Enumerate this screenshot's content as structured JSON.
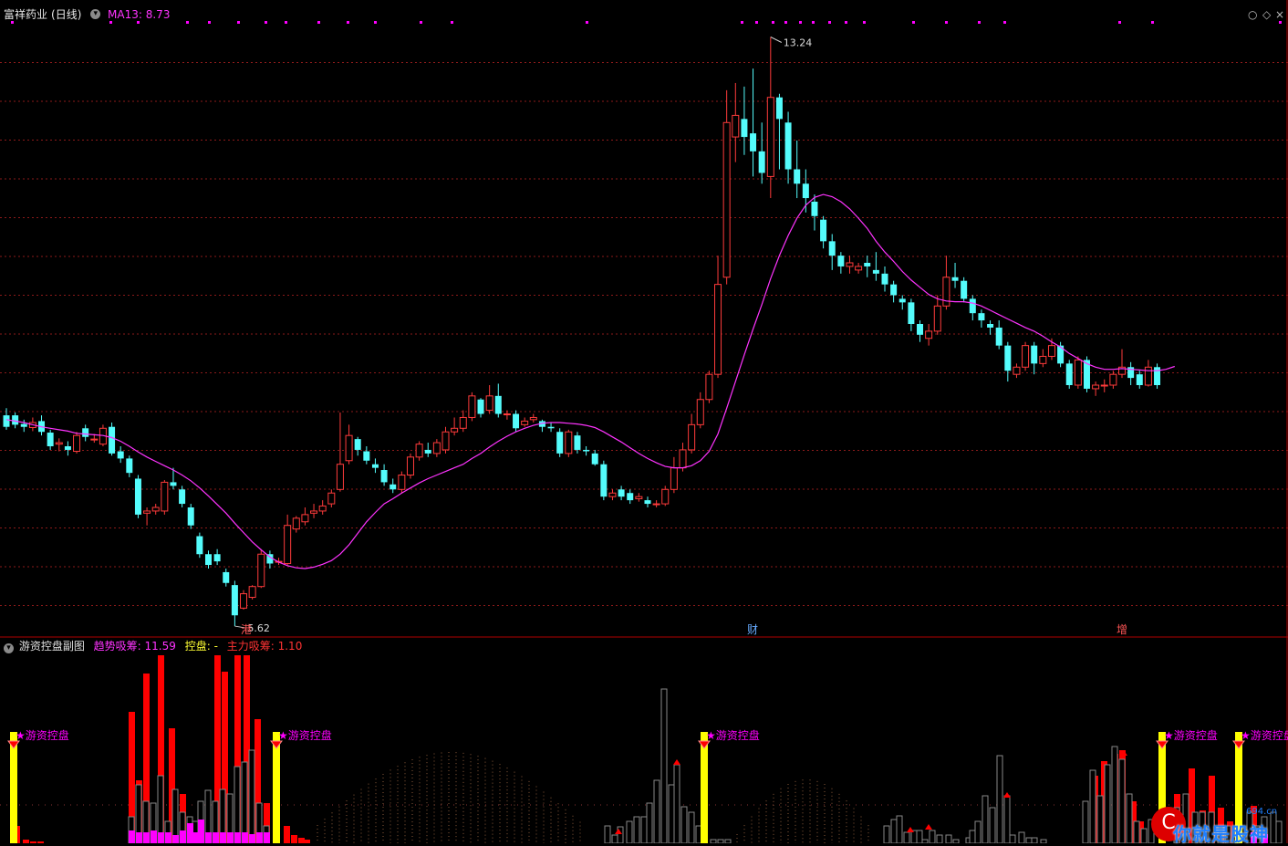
{
  "stock": {
    "name": "富祥药业",
    "period": "(日线)",
    "ma_label": "MA13: 8.73"
  },
  "sub": {
    "name": "游资控盘副图",
    "trend_label": "趋势吸筹: 11.59",
    "ctrl_label": "控盘: -",
    "main_label": "主力吸筹: 1.10",
    "signal_label": "★游资控盘"
  },
  "window_buttons": [
    "○",
    "◇",
    "×"
  ],
  "event_markers": [
    "港",
    "财",
    "增"
  ],
  "colors": {
    "up": "#ff3b3b",
    "down": "#54fcfc",
    "ma": "#ff33ff",
    "grid": "#8b1a1a",
    "yellow": "#ffff00",
    "magenta": "#ff00ff",
    "red": "#ff0000"
  },
  "chart_data": {
    "type": "candlestick",
    "title": "富祥药业 (日线)",
    "y_range": [
      5.0,
      13.5
    ],
    "high_label": "13.24",
    "low_label": "5.62",
    "ma13_current": 8.73,
    "candles": [
      [
        7.98,
        7.82,
        8.08,
        7.78
      ],
      [
        7.98,
        7.85,
        8.02,
        7.8
      ],
      [
        7.86,
        7.82,
        7.92,
        7.75
      ],
      [
        7.81,
        7.88,
        7.95,
        7.76
      ],
      [
        7.9,
        7.75,
        7.98,
        7.7
      ],
      [
        7.74,
        7.55,
        7.78,
        7.5
      ],
      [
        7.58,
        7.6,
        7.66,
        7.48
      ],
      [
        7.55,
        7.5,
        7.62,
        7.42
      ],
      [
        7.48,
        7.7,
        7.75,
        7.45
      ],
      [
        7.8,
        7.68,
        7.85,
        7.62
      ],
      [
        7.65,
        7.65,
        7.72,
        7.6
      ],
      [
        7.58,
        7.8,
        7.85,
        7.55
      ],
      [
        7.82,
        7.45,
        7.88,
        7.42
      ],
      [
        7.48,
        7.38,
        7.55,
        7.32
      ],
      [
        7.38,
        7.18,
        7.42,
        7.12
      ],
      [
        7.1,
        6.6,
        7.15,
        6.55
      ],
      [
        6.62,
        6.65,
        6.7,
        6.45
      ],
      [
        6.65,
        6.7,
        6.75,
        6.6
      ],
      [
        6.65,
        7.05,
        7.08,
        6.6
      ],
      [
        7.05,
        7.0,
        7.25,
        6.95
      ],
      [
        6.95,
        6.75,
        7.0,
        6.7
      ],
      [
        6.7,
        6.45,
        6.75,
        6.4
      ],
      [
        6.3,
        6.05,
        6.35,
        6.0
      ],
      [
        6.05,
        5.9,
        6.1,
        5.85
      ],
      [
        6.05,
        5.95,
        6.12,
        5.9
      ],
      [
        5.8,
        5.65,
        5.85,
        5.6
      ],
      [
        5.62,
        5.2,
        5.68,
        5.05
      ],
      [
        5.3,
        5.5,
        5.55,
        5.28
      ],
      [
        5.45,
        5.6,
        5.62,
        5.42
      ],
      [
        5.6,
        6.05,
        6.12,
        5.58
      ],
      [
        6.05,
        5.92,
        6.1,
        5.85
      ],
      [
        5.95,
        5.95,
        6.0,
        5.9
      ],
      [
        5.92,
        6.45,
        6.6,
        5.9
      ],
      [
        6.4,
        6.55,
        6.58,
        6.35
      ],
      [
        6.5,
        6.6,
        6.7,
        6.45
      ],
      [
        6.62,
        6.65,
        6.75,
        6.55
      ],
      [
        6.65,
        6.72,
        6.8,
        6.6
      ],
      [
        6.75,
        6.9,
        6.95,
        6.7
      ],
      [
        6.95,
        7.3,
        8.02,
        6.92
      ],
      [
        7.35,
        7.7,
        7.85,
        7.3
      ],
      [
        7.65,
        7.5,
        7.68,
        7.42
      ],
      [
        7.48,
        7.35,
        7.55,
        7.3
      ],
      [
        7.3,
        7.25,
        7.38,
        7.18
      ],
      [
        7.22,
        7.05,
        7.3,
        7.0
      ],
      [
        7.02,
        6.95,
        7.1,
        6.9
      ],
      [
        6.95,
        7.15,
        7.2,
        6.9
      ],
      [
        7.15,
        7.4,
        7.45,
        7.1
      ],
      [
        7.4,
        7.58,
        7.62,
        7.35
      ],
      [
        7.5,
        7.45,
        7.6,
        7.4
      ],
      [
        7.45,
        7.6,
        7.65,
        7.4
      ],
      [
        7.5,
        7.75,
        7.82,
        7.45
      ],
      [
        7.75,
        7.8,
        7.95,
        7.7
      ],
      [
        7.8,
        7.95,
        8.05,
        7.75
      ],
      [
        7.95,
        8.25,
        8.3,
        7.9
      ],
      [
        8.2,
        8.0,
        8.22,
        7.95
      ],
      [
        8.05,
        8.25,
        8.4,
        8.0
      ],
      [
        8.25,
        8.0,
        8.42,
        7.95
      ],
      [
        8.0,
        8.0,
        8.05,
        7.92
      ],
      [
        8.0,
        7.8,
        8.05,
        7.75
      ],
      [
        7.85,
        7.9,
        7.95,
        7.82
      ],
      [
        7.92,
        7.95,
        8.0,
        7.88
      ],
      [
        7.9,
        7.82,
        7.92,
        7.75
      ],
      [
        7.82,
        7.8,
        7.88,
        7.75
      ],
      [
        7.75,
        7.45,
        7.8,
        7.4
      ],
      [
        7.45,
        7.75,
        7.78,
        7.4
      ],
      [
        7.7,
        7.5,
        7.75,
        7.45
      ],
      [
        7.5,
        7.48,
        7.55,
        7.42
      ],
      [
        7.45,
        7.3,
        7.5,
        7.28
      ],
      [
        7.3,
        6.85,
        7.35,
        6.8
      ],
      [
        6.85,
        6.9,
        6.95,
        6.8
      ],
      [
        6.95,
        6.85,
        7.0,
        6.8
      ],
      [
        6.9,
        6.8,
        6.95,
        6.75
      ],
      [
        6.82,
        6.85,
        6.9,
        6.78
      ],
      [
        6.8,
        6.75,
        6.85,
        6.7
      ],
      [
        6.75,
        6.75,
        6.8,
        6.7
      ],
      [
        6.75,
        6.95,
        7.0,
        6.72
      ],
      [
        6.95,
        7.25,
        7.4,
        6.9
      ],
      [
        7.25,
        7.5,
        7.6,
        7.2
      ],
      [
        7.5,
        7.85,
        8.0,
        7.45
      ],
      [
        7.85,
        8.2,
        8.3,
        7.8
      ],
      [
        8.2,
        8.55,
        8.6,
        8.15
      ],
      [
        8.55,
        9.8,
        10.2,
        8.5
      ],
      [
        9.9,
        12.05,
        12.5,
        9.8
      ],
      [
        11.85,
        12.15,
        12.6,
        11.5
      ],
      [
        12.1,
        11.85,
        12.55,
        11.6
      ],
      [
        11.9,
        11.65,
        12.8,
        11.3
      ],
      [
        11.65,
        11.35,
        12.05,
        11.2
      ],
      [
        11.3,
        12.4,
        13.24,
        11.0
      ],
      [
        12.4,
        12.1,
        12.45,
        11.4
      ],
      [
        12.05,
        11.4,
        12.2,
        11.2
      ],
      [
        11.4,
        11.2,
        11.8,
        11.0
      ],
      [
        11.2,
        11.0,
        11.4,
        10.8
      ],
      [
        10.95,
        10.75,
        11.05,
        10.55
      ],
      [
        10.7,
        10.4,
        10.75,
        10.3
      ],
      [
        10.4,
        10.2,
        10.5,
        10.0
      ],
      [
        10.2,
        10.05,
        10.25,
        9.95
      ],
      [
        10.05,
        10.1,
        10.2,
        9.95
      ],
      [
        10.0,
        10.05,
        10.1,
        9.95
      ],
      [
        10.1,
        10.05,
        10.2,
        9.9
      ],
      [
        10.0,
        9.95,
        10.25,
        9.85
      ],
      [
        9.95,
        9.8,
        10.05,
        9.7
      ],
      [
        9.8,
        9.65,
        9.85,
        9.55
      ],
      [
        9.6,
        9.55,
        9.65,
        9.45
      ],
      [
        9.55,
        9.25,
        9.6,
        9.15
      ],
      [
        9.25,
        9.1,
        9.3,
        9.0
      ],
      [
        9.05,
        9.15,
        9.25,
        8.95
      ],
      [
        9.15,
        9.5,
        9.65,
        9.1
      ],
      [
        9.5,
        9.9,
        10.2,
        9.45
      ],
      [
        9.9,
        9.85,
        10.1,
        9.75
      ],
      [
        9.85,
        9.6,
        9.9,
        9.55
      ],
      [
        9.6,
        9.4,
        9.65,
        9.3
      ],
      [
        9.4,
        9.3,
        9.45,
        9.2
      ],
      [
        9.25,
        9.2,
        9.3,
        9.1
      ],
      [
        9.2,
        8.95,
        9.3,
        8.9
      ],
      [
        8.95,
        8.6,
        9.0,
        8.45
      ],
      [
        8.55,
        8.65,
        8.7,
        8.5
      ],
      [
        8.65,
        8.95,
        9.0,
        8.6
      ],
      [
        8.95,
        8.7,
        9.0,
        8.55
      ],
      [
        8.7,
        8.8,
        8.9,
        8.65
      ],
      [
        8.8,
        8.95,
        9.05,
        8.75
      ],
      [
        8.95,
        8.7,
        9.0,
        8.65
      ],
      [
        8.7,
        8.4,
        8.75,
        8.35
      ],
      [
        8.4,
        8.75,
        8.8,
        8.35
      ],
      [
        8.75,
        8.35,
        8.8,
        8.3
      ],
      [
        8.35,
        8.4,
        8.45,
        8.25
      ],
      [
        8.4,
        8.4,
        8.48,
        8.3
      ],
      [
        8.4,
        8.55,
        8.6,
        8.35
      ],
      [
        8.55,
        8.65,
        8.9,
        8.5
      ],
      [
        8.65,
        8.5,
        8.72,
        8.4
      ],
      [
        8.55,
        8.4,
        8.6,
        8.35
      ],
      [
        8.4,
        8.65,
        8.75,
        8.38
      ],
      [
        8.65,
        8.4,
        8.7,
        8.35
      ]
    ],
    "ma13": [
      7.92,
      7.9,
      7.88,
      7.85,
      7.82,
      7.8,
      7.78,
      7.76,
      7.73,
      7.72,
      7.71,
      7.7,
      7.67,
      7.62,
      7.55,
      7.47,
      7.4,
      7.34,
      7.28,
      7.22,
      7.15,
      7.07,
      6.97,
      6.86,
      6.74,
      6.62,
      6.48,
      6.35,
      6.22,
      6.11,
      6.01,
      5.94,
      5.89,
      5.86,
      5.85,
      5.87,
      5.91,
      5.96,
      6.05,
      6.18,
      6.34,
      6.5,
      6.63,
      6.75,
      6.82,
      6.9,
      6.97,
      7.04,
      7.1,
      7.15,
      7.2,
      7.25,
      7.3,
      7.38,
      7.45,
      7.54,
      7.62,
      7.69,
      7.75,
      7.8,
      7.84,
      7.87,
      7.88,
      7.88,
      7.87,
      7.86,
      7.84,
      7.81,
      7.75,
      7.68,
      7.61,
      7.53,
      7.45,
      7.38,
      7.32,
      7.27,
      7.25,
      7.25,
      7.28,
      7.35,
      7.48,
      7.72,
      8.08,
      8.45,
      8.82,
      9.18,
      9.52,
      9.88,
      10.2,
      10.48,
      10.72,
      10.9,
      11.01,
      11.05,
      11.02,
      10.95,
      10.85,
      10.72,
      10.58,
      10.4,
      10.25,
      10.12,
      9.98,
      9.86,
      9.76,
      9.66,
      9.6,
      9.57,
      9.56,
      9.56,
      9.54,
      9.5,
      9.44,
      9.38,
      9.32,
      9.26,
      9.2,
      9.15,
      9.08,
      9.0,
      8.93,
      8.84,
      8.77,
      8.7,
      8.65,
      8.62,
      8.62,
      8.63,
      8.62,
      8.61,
      8.6,
      8.6,
      8.62,
      8.66
    ]
  }
}
